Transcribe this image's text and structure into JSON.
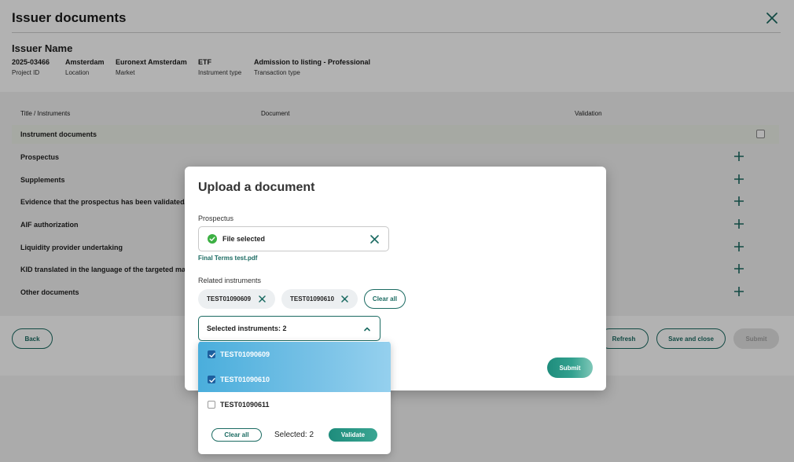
{
  "page": {
    "title": "Issuer documents",
    "issuer_name": "Issuer Name",
    "meta": [
      {
        "value": "2025-03466",
        "key": "Project ID"
      },
      {
        "value": "Amsterdam",
        "key": "Location"
      },
      {
        "value": "Euronext Amsterdam",
        "key": "Market"
      },
      {
        "value": "ETF",
        "key": "Instrument type"
      },
      {
        "value": "Admission to listing - Professional",
        "key": "Transaction type"
      }
    ],
    "columns": [
      "Title / Instruments",
      "Document",
      "Validation"
    ],
    "rows": [
      "Instrument documents",
      "Prospectus",
      "Supplements",
      "Evidence that the prospectus has been validated/p",
      "AIF authorization",
      "Liquidity provider undertaking",
      "KID translated in the language of the targeted mar",
      "Other documents"
    ],
    "buttons": {
      "back": "Back",
      "refresh": "Refresh",
      "save_close": "Save and close",
      "submit": "Submit"
    }
  },
  "modal": {
    "title": "Upload a document",
    "prospectus_label": "Prospectus",
    "file_status": "File selected",
    "file_name": "Final Terms test.pdf",
    "related_label": "Related instruments",
    "chips": [
      "TEST01090609",
      "TEST01090610"
    ],
    "clear_all": "Clear all",
    "select_text": "Selected instruments: 2",
    "submit": "Submit"
  },
  "dropdown": {
    "options": [
      {
        "label": "TEST01090609",
        "checked": true
      },
      {
        "label": "TEST01090610",
        "checked": true
      },
      {
        "label": "TEST01090611",
        "checked": false
      }
    ],
    "clear_all": "Clear all",
    "selected_count": "Selected: 2",
    "validate": "Validate"
  },
  "colors": {
    "accent": "#1b6b62",
    "selection": "#4aaedc",
    "success": "#3cb043"
  }
}
